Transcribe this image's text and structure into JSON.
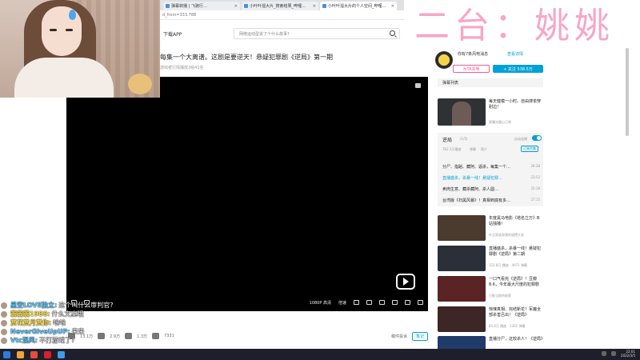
{
  "browser": {
    "tabs": [
      {
        "label": "弹幕转播 | 飞驰行…"
      },
      {
        "label": "小叶叶溜大片_搜索结果_哔哩…"
      },
      {
        "label": "小叶叶溜大片的个人空间_哔哩…"
      }
    ],
    "address": "d_from=333.788"
  },
  "overlay": {
    "title": "二台：姚姚"
  },
  "header": {
    "download_app": "下载APP",
    "search_placeholder": "网络运动型说了个什么故事?"
  },
  "video": {
    "title": "每集一个大离谱。这剧是要逆天！悬疑犯罪剧《逆局》第一期",
    "meta": "游戏者行情播放3组41名"
  },
  "player": {
    "quality": "1080P 高清",
    "speed": "倍速"
  },
  "below_player": {
    "likes": "13.1万",
    "coins": "2.9万",
    "favorites": "1.3万",
    "shares": "7331",
    "report": "稿件投诉",
    "note": "笔记"
  },
  "sidebar": {
    "up_name": "你有7条风电消息",
    "view_detail": "查看详情",
    "charge": "为TA充电",
    "follow": "+ 关注 538.5万",
    "danmaku_list": "弹幕列表",
    "top_rec": {
      "title": "每天健模一小时。自由搜单穿耐边！",
      "meta": "星瞳光健心日常"
    },
    "playlist": {
      "title": "逆局",
      "count": "(1/5)",
      "auto": "自动连播",
      "views": "762.1万播放",
      "sub1": "弹幕",
      "sub2": "简介",
      "subscribe": "订阅合集",
      "items": [
        {
          "title": "分尸、指蹈、藏阿、逼杀，每集一个…",
          "duration": "26:38"
        },
        {
          "title": "直播盛杀，杀暴一线！悬疑犯罪…",
          "duration": "23:52"
        },
        {
          "title": "卖肉生意、藏杀藏阿、杀人圆…",
          "duration": "25:16"
        },
        {
          "title": "台湾版《扫黑风暴》！真相到底有多…",
          "duration": "27:15"
        }
      ]
    },
    "recs": [
      {
        "title": "年度黑马电影《塔名立万》B站独播！",
        "meta": "叶丑家族和我的道德大发"
      },
      {
        "title": "直播盛杀，杀暴一线！悬疑犯罪剧《逆局》第二期",
        "meta": "152.8万 播放 · 4971 弹幕"
      },
      {
        "title": "一口气看完《逆局》！豆瓣8.6，今年最大尺度的犯罪剧",
        "meta": "只推当前的收获"
      },
      {
        "title": "惊悚真相、完结新花！军魔全部杀害吕出！《逆局》",
        "meta": "85.6万 播放 · 1301 弹幕"
      },
      {
        "title": "直播分尸，这较杀人！《逆局》",
        "meta": ""
      }
    ]
  },
  "chat": [
    {
      "name": "星空LOVE独立:",
      "msg": "这个叫什么审判官?",
      "color": "#5ec8ff"
    },
    {
      "name": "翡翡翡1988:",
      "msg": "什么文案哦",
      "color": "#ffe14d"
    },
    {
      "name": "赏花赏月赏你:",
      "msg": "哈哈",
      "color": "#ffe14d"
    },
    {
      "name": "NeverGiveUpUP:",
      "msg": "来来",
      "color": "#5ec8ff"
    },
    {
      "name": "Vtc混风:",
      "msg": "不打游戏了?",
      "color": "#5ec8ff"
    }
  ],
  "taskbar": {
    "clock_time": "22:01",
    "clock_date": "2022/3/5"
  },
  "colors": {
    "accent": "#00a1d6",
    "pink": "#f25d8e",
    "overlay": "#f7a6c6"
  }
}
